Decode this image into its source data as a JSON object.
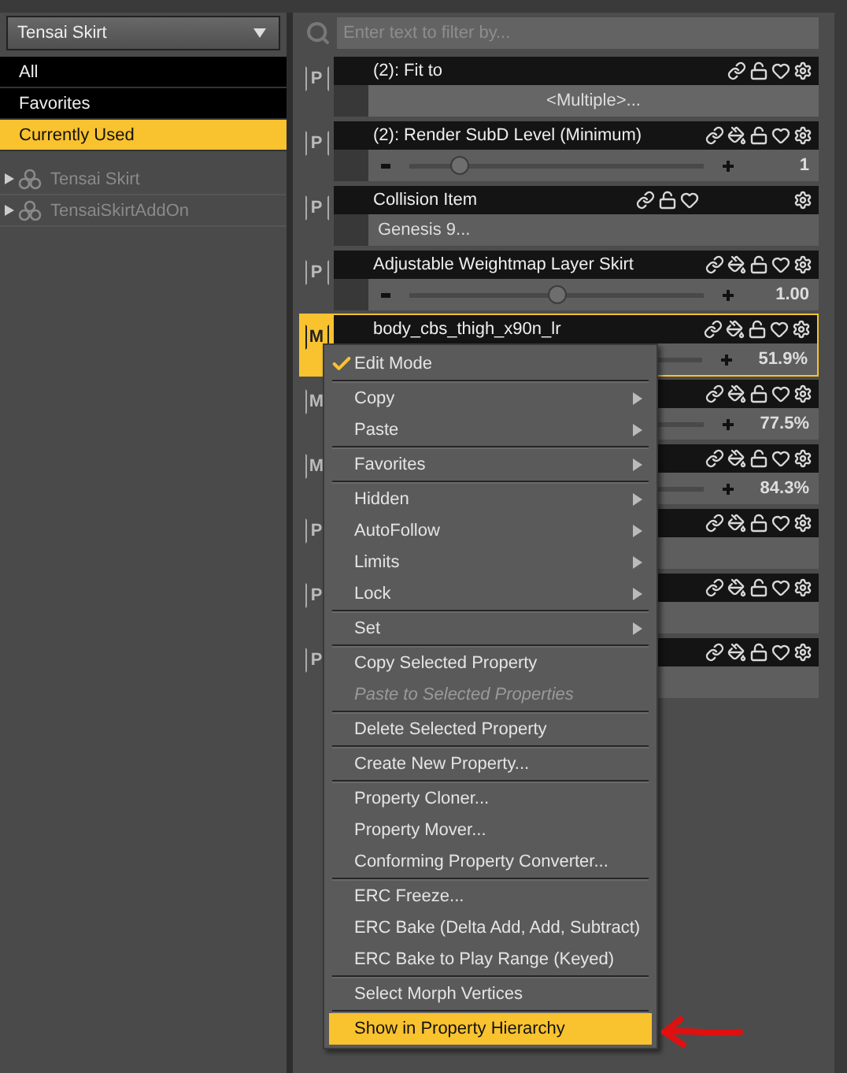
{
  "scene_selector": {
    "value": "Tensai Skirt"
  },
  "filters": [
    {
      "label": "All",
      "selected": false
    },
    {
      "label": "Favorites",
      "selected": false
    },
    {
      "label": "Currently Used",
      "selected": true
    }
  ],
  "tree": [
    {
      "label": "Tensai Skirt",
      "expanded": false
    },
    {
      "label": "TensaiSkirtAddOn",
      "expanded": false
    }
  ],
  "search": {
    "placeholder": "Enter text to filter by..."
  },
  "properties": [
    {
      "badge": "P",
      "title": "(2): Fit to",
      "selected": false,
      "kind": "button",
      "value": "<Multiple>...",
      "paint_icon": false,
      "gear_apart": false
    },
    {
      "badge": "P",
      "title": "(2): Render SubD Level (Minimum)",
      "selected": false,
      "kind": "slider",
      "level": 0.17,
      "value": "1",
      "paint_icon": true,
      "gear_apart": false
    },
    {
      "badge": "P",
      "title": "Collision Item",
      "selected": false,
      "kind": "field",
      "value": "Genesis 9...",
      "paint_icon": false,
      "gear_apart": true
    },
    {
      "badge": "P",
      "title": "Adjustable Weightmap Layer Skirt",
      "selected": false,
      "kind": "slider",
      "level": 0.5,
      "value": "1.00",
      "paint_icon": true,
      "gear_apart": false
    },
    {
      "badge": "M",
      "title": "body_cbs_thigh_x90n_lr",
      "selected": true,
      "kind": "slider",
      "value": "51.9%",
      "paint_icon": true,
      "gear_apart": false
    },
    {
      "badge": "M",
      "selected": false,
      "kind": "slider",
      "value": "77.5%",
      "paint_icon": true,
      "gear_apart": false
    },
    {
      "badge": "M",
      "selected": false,
      "kind": "slider",
      "value": "84.3%",
      "paint_icon": true,
      "gear_apart": false
    },
    {
      "badge": "P",
      "selected": false,
      "kind": "blank",
      "paint_icon": true,
      "gear_apart": false
    },
    {
      "badge": "P",
      "selected": false,
      "kind": "blank",
      "paint_icon": true,
      "gear_apart": false
    },
    {
      "badge": "P",
      "selected": false,
      "kind": "blank",
      "paint_icon": true,
      "gear_apart": false
    }
  ],
  "context_menu": {
    "items": [
      {
        "kind": "item",
        "label": "Edit Mode",
        "checked": true,
        "submenu": false,
        "disabled": false,
        "selected": false
      },
      {
        "kind": "separator"
      },
      {
        "kind": "item",
        "label": "Copy",
        "checked": false,
        "submenu": true,
        "disabled": false,
        "selected": false
      },
      {
        "kind": "item",
        "label": "Paste",
        "checked": false,
        "submenu": true,
        "disabled": false,
        "selected": false
      },
      {
        "kind": "separator"
      },
      {
        "kind": "item",
        "label": "Favorites",
        "checked": false,
        "submenu": true,
        "disabled": false,
        "selected": false
      },
      {
        "kind": "separator"
      },
      {
        "kind": "item",
        "label": "Hidden",
        "checked": false,
        "submenu": true,
        "disabled": false,
        "selected": false
      },
      {
        "kind": "item",
        "label": "AutoFollow",
        "checked": false,
        "submenu": true,
        "disabled": false,
        "selected": false
      },
      {
        "kind": "item",
        "label": "Limits",
        "checked": false,
        "submenu": true,
        "disabled": false,
        "selected": false
      },
      {
        "kind": "item",
        "label": "Lock",
        "checked": false,
        "submenu": true,
        "disabled": false,
        "selected": false
      },
      {
        "kind": "separator"
      },
      {
        "kind": "item",
        "label": "Set",
        "checked": false,
        "submenu": true,
        "disabled": false,
        "selected": false
      },
      {
        "kind": "separator"
      },
      {
        "kind": "item",
        "label": "Copy Selected Property",
        "checked": false,
        "submenu": false,
        "disabled": false,
        "selected": false
      },
      {
        "kind": "item",
        "label": "Paste to Selected Properties",
        "checked": false,
        "submenu": false,
        "disabled": true,
        "selected": false
      },
      {
        "kind": "separator"
      },
      {
        "kind": "item",
        "label": "Delete Selected Property",
        "checked": false,
        "submenu": false,
        "disabled": false,
        "selected": false
      },
      {
        "kind": "separator"
      },
      {
        "kind": "item",
        "label": "Create New Property...",
        "checked": false,
        "submenu": false,
        "disabled": false,
        "selected": false
      },
      {
        "kind": "separator"
      },
      {
        "kind": "item",
        "label": "Property Cloner...",
        "checked": false,
        "submenu": false,
        "disabled": false,
        "selected": false
      },
      {
        "kind": "item",
        "label": "Property Mover...",
        "checked": false,
        "submenu": false,
        "disabled": false,
        "selected": false
      },
      {
        "kind": "item",
        "label": "Conforming Property Converter...",
        "checked": false,
        "submenu": false,
        "disabled": false,
        "selected": false
      },
      {
        "kind": "separator"
      },
      {
        "kind": "item",
        "label": "ERC Freeze...",
        "checked": false,
        "submenu": false,
        "disabled": false,
        "selected": false
      },
      {
        "kind": "item",
        "label": "ERC Bake (Delta Add, Add, Subtract)",
        "checked": false,
        "submenu": false,
        "disabled": false,
        "selected": false
      },
      {
        "kind": "item",
        "label": "ERC Bake to Play Range (Keyed)",
        "checked": false,
        "submenu": false,
        "disabled": false,
        "selected": false
      },
      {
        "kind": "separator"
      },
      {
        "kind": "item",
        "label": "Select Morph Vertices",
        "checked": false,
        "submenu": false,
        "disabled": false,
        "selected": false
      },
      {
        "kind": "separator"
      },
      {
        "kind": "item",
        "label": "Show in Property Hierarchy",
        "checked": false,
        "submenu": false,
        "disabled": false,
        "selected": true
      }
    ]
  }
}
